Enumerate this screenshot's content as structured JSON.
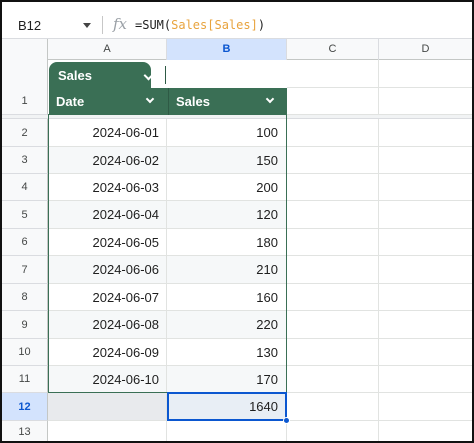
{
  "formula_bar": {
    "name_box": "B12",
    "fx_symbol": "fx",
    "formula_prefix": "=SUM(",
    "formula_ref": "Sales[Sales]",
    "formula_suffix": ")"
  },
  "columns": [
    "A",
    "B",
    "C",
    "D"
  ],
  "selected_column": "B",
  "table": {
    "name": "Sales",
    "headers": [
      "Date",
      "Sales"
    ]
  },
  "rows": [
    {
      "row": "2",
      "date": "2024-06-01",
      "sales": "100"
    },
    {
      "row": "3",
      "date": "2024-06-02",
      "sales": "150"
    },
    {
      "row": "4",
      "date": "2024-06-03",
      "sales": "200"
    },
    {
      "row": "5",
      "date": "2024-06-04",
      "sales": "120"
    },
    {
      "row": "6",
      "date": "2024-06-05",
      "sales": "180"
    },
    {
      "row": "7",
      "date": "2024-06-06",
      "sales": "210"
    },
    {
      "row": "8",
      "date": "2024-06-07",
      "sales": "160"
    },
    {
      "row": "9",
      "date": "2024-06-08",
      "sales": "220"
    },
    {
      "row": "10",
      "date": "2024-06-09",
      "sales": "130"
    },
    {
      "row": "11",
      "date": "2024-06-10",
      "sales": "170"
    }
  ],
  "header_row_number": "1",
  "total_row": {
    "row": "12",
    "value": "1640"
  },
  "after_row": "13",
  "colors": {
    "table_header": "#3a6f55",
    "selection": "#0b57d0",
    "formula_ref": "#e8a33d"
  }
}
